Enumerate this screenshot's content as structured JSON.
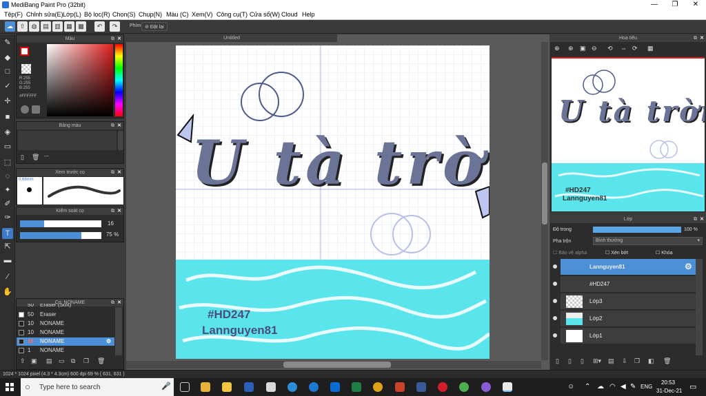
{
  "window": {
    "title": "MediBang Paint Pro (32bit)",
    "minimize": "—",
    "maximize": "❐",
    "close": "✕"
  },
  "menu": [
    "Tệp(F)",
    "Chỉnh sửa(E)",
    "Lớp(L)",
    "Bộ lọc(R)",
    "Chọn(S)",
    "Chụp(N)",
    "Màu (C)",
    "Xem(V)",
    "Công cụ(T)",
    "Cửa sổ(W)",
    "Cloud",
    "Help"
  ],
  "toolbar": {
    "key_label": "Phím",
    "reset_label": "Đặt lại"
  },
  "panels": {
    "color": {
      "title": "Màu",
      "r": "R:255",
      "g": "G:255",
      "b": "B:255",
      "hex": "#FFFFFF"
    },
    "palette": {
      "title": "Bảng màu",
      "dash": "---"
    },
    "brush_preview": {
      "title": "Xem trước cọ",
      "size": "0.68mm"
    },
    "brush_control": {
      "title": "Kiểm soát cọ",
      "size_value": "16",
      "opacity_value": "75 %",
      "size_fill": 0.3,
      "opacity_fill": 0.75
    },
    "brush_list": {
      "title": "Cọ: NONAME",
      "items": [
        {
          "num": "50",
          "name": "Eraser (Soft)"
        },
        {
          "num": "50",
          "name": "Eraser"
        },
        {
          "num": "10",
          "name": "NONAME"
        },
        {
          "num": "10",
          "name": "NONAME"
        },
        {
          "num": "16",
          "name": "NONAME",
          "selected": true
        },
        {
          "num": "1",
          "name": "NONAME"
        }
      ]
    },
    "navigator": {
      "title": "Hoa tiêu"
    },
    "layer": {
      "title": "Lớp",
      "opacity_label": "Độ trong",
      "opacity_value": "100 %",
      "blend_label": "Pha trộn",
      "blend_value": "Bình thường",
      "protect_alpha": "Bảo vệ alpha",
      "clipping": "Xén bớt",
      "lock": "Khóa",
      "layers": [
        "Lannguyen81",
        "#HD247",
        "Lớp3",
        "Lớp2",
        "Lớp1"
      ]
    }
  },
  "document": {
    "tab": "Untitled",
    "title_art": "U tà trời",
    "hashtag": "#HD247",
    "author": "Lannguyen81"
  },
  "status": "1024 * 1024 pixel   (4.3 * 4.3cm)   600 dpi   69 %   ( 631, 631 )",
  "taskbar": {
    "search_placeholder": "Type here to search",
    "lang": "ENG",
    "time": "20:53",
    "date": "31-Dec-21"
  },
  "colors": {
    "accent": "#4b8fd6",
    "water": "#5ae5ec",
    "lettering": "#6b7396"
  }
}
